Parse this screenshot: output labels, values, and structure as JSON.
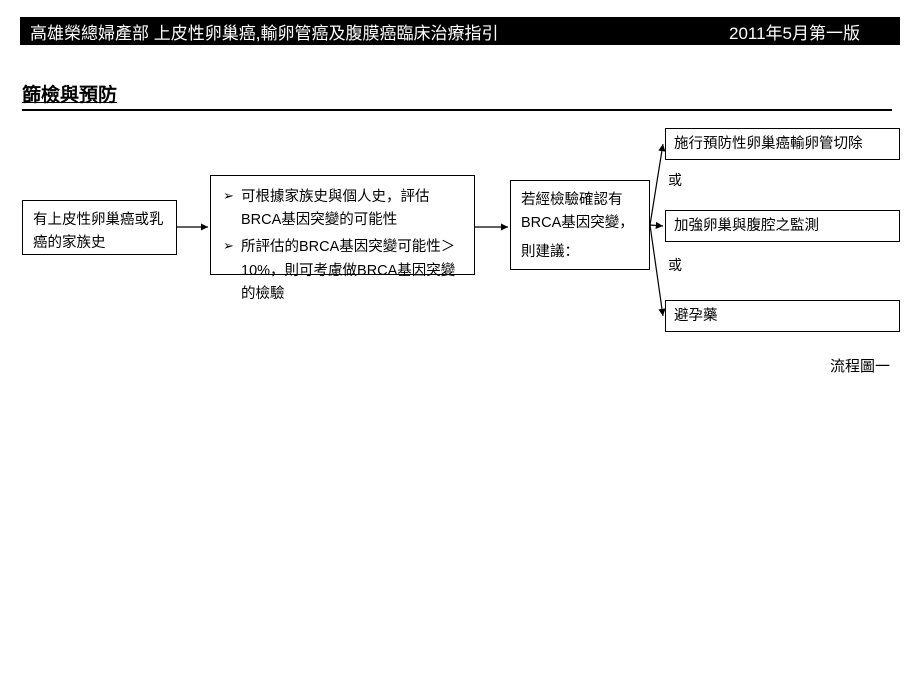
{
  "header": {
    "left": "高雄榮總婦產部  上皮性卵巢癌,輸卵管癌及腹膜癌臨床治療指引",
    "right": "2011年5月第一版"
  },
  "section_title": "篩檢與預防",
  "boxes": {
    "box1": "有上皮性卵巢癌或乳癌的家族史",
    "box2_bullet1": "可根據家族史與個人史，評估BRCA基因突變的可能性",
    "box2_bullet2": "所評估的BRCA基因突變可能性＞10%，則可考慮做BRCA基因突變的檢驗",
    "box3_line1": "若經檢驗確認有",
    "box3_line2": "BRCA基因突變，",
    "box3_line3": "則建議：",
    "optA": "施行預防性卵巢癌輸卵管切除",
    "optB": "加強卵巢與腹腔之監測",
    "optC": "避孕藥"
  },
  "labels": {
    "or": "或",
    "caption": "流程圖一"
  }
}
